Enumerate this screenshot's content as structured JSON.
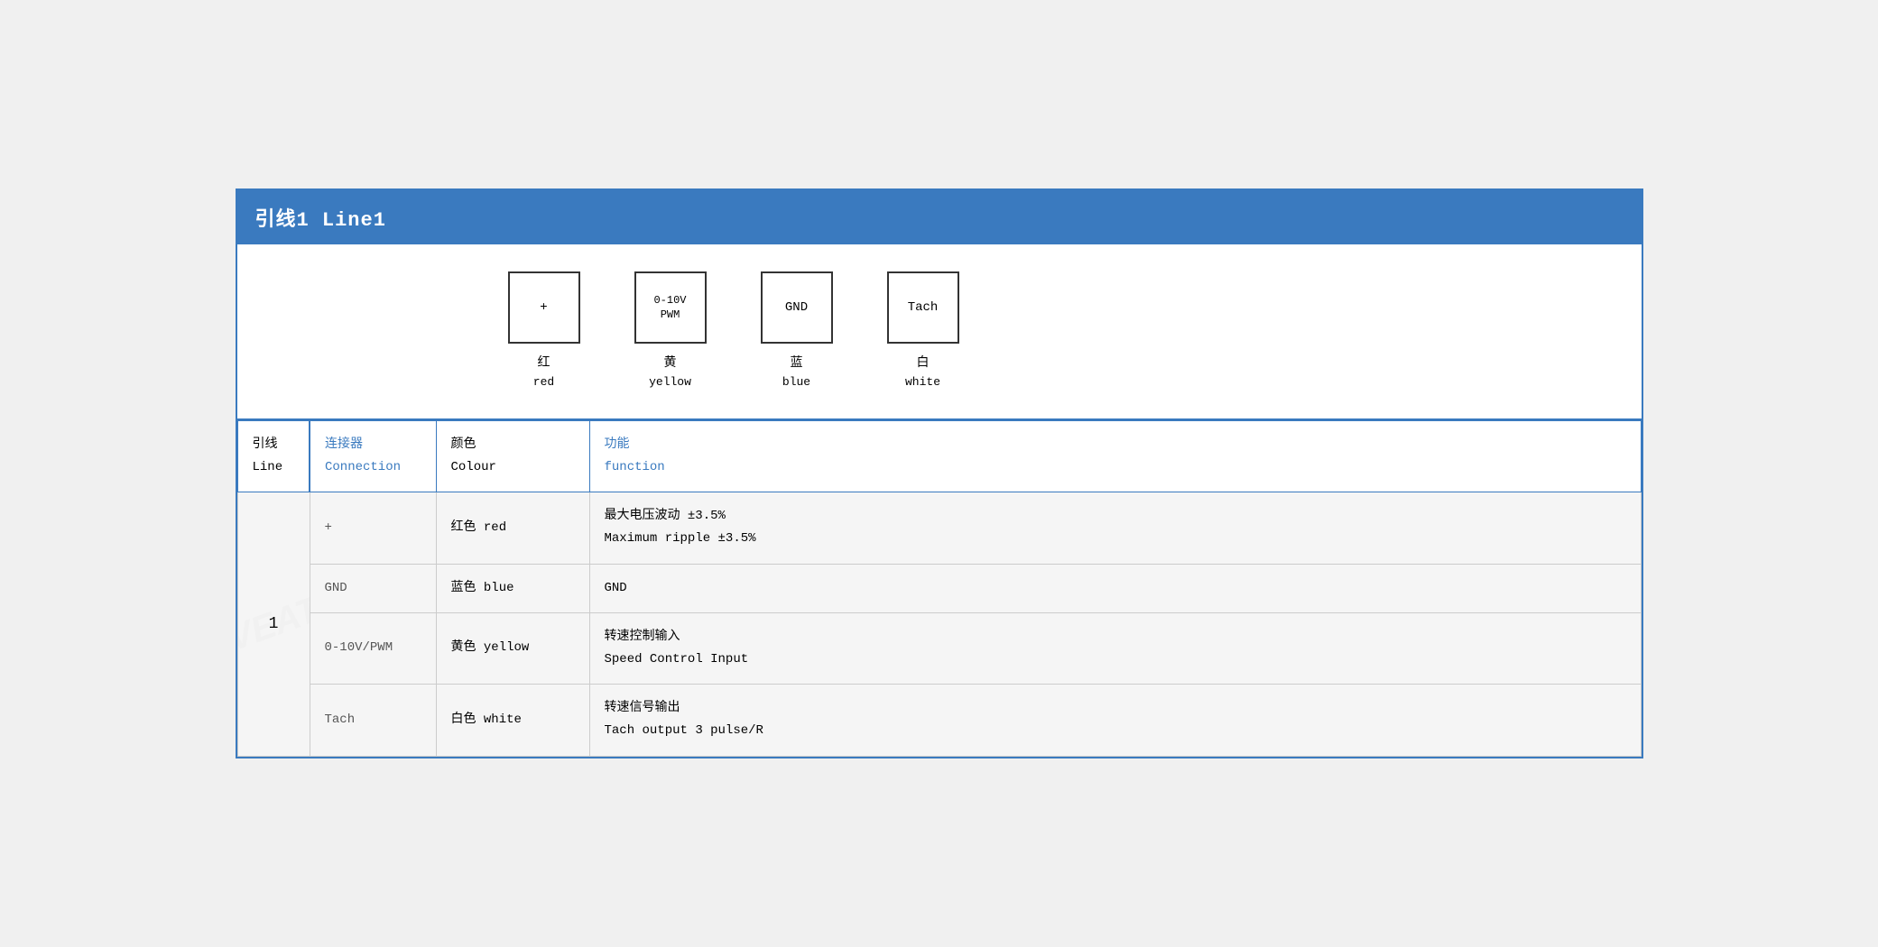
{
  "header": {
    "title": "引线1 Line1"
  },
  "diagram": {
    "connectors": [
      {
        "id": "plus",
        "label": "+",
        "chinese": "红",
        "english": "red"
      },
      {
        "id": "pwm",
        "label": "0-10V\nPWM",
        "chinese": "黄",
        "english": "yellow"
      },
      {
        "id": "gnd",
        "label": "GND",
        "chinese": "蓝",
        "english": "blue"
      },
      {
        "id": "tach",
        "label": "Tach",
        "chinese": "白",
        "english": "white"
      }
    ]
  },
  "table": {
    "headers": {
      "line": {
        "chinese": "引线",
        "english": "Line"
      },
      "connection": {
        "chinese": "连接器",
        "english": "Connection"
      },
      "colour": {
        "chinese": "颜色",
        "english": "Colour"
      },
      "function": {
        "chinese": "功能",
        "english": "function"
      }
    },
    "rows": [
      {
        "line": "1",
        "connection": "+",
        "colour_chinese": "红色",
        "colour_english": "red",
        "function_chinese": "最大电压波动 ±3.5%",
        "function_english": "Maximum ripple ±3.5%",
        "rowspan": 4
      },
      {
        "connection": "GND",
        "colour_chinese": "蓝色",
        "colour_english": "blue",
        "function_chinese": "GND",
        "function_english": ""
      },
      {
        "connection": "0-10V/PWM",
        "colour_chinese": "黄色",
        "colour_english": "yellow",
        "function_chinese": "转速控制输入",
        "function_english": "Speed Control Input"
      },
      {
        "connection": "Tach",
        "colour_chinese": "白色",
        "colour_english": "white",
        "function_chinese": "转速信号输出",
        "function_english": "Tach output 3 pulse/R"
      }
    ]
  }
}
